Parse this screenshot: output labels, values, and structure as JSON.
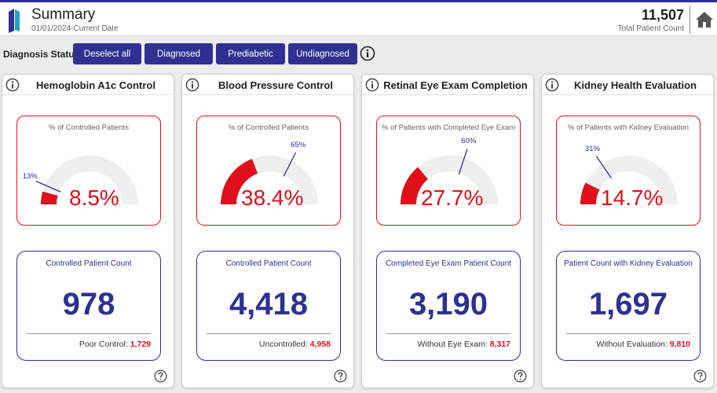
{
  "header": {
    "title": "Summary",
    "subtitle": "01/01/2024-Current Date",
    "total_count": "11,507",
    "total_label": "Total Patient Count"
  },
  "filters": {
    "label": "Diagnosis Status:",
    "buttons": [
      "Deselect all",
      "Diagnosed",
      "Prediabetic",
      "Undiagnosed"
    ]
  },
  "colors": {
    "navy": "#2e3192",
    "red": "#e0101a",
    "track": "#efefef"
  },
  "cards": [
    {
      "title": "Hemoglobin A1c Control",
      "gauge_caption": "% of Controlled Patients",
      "value_pct": 8.5,
      "value_label": "8.5%",
      "target_pct": 13,
      "target_label": "13%",
      "count_caption": "Controlled Patient Count",
      "count": "978",
      "sub_label": "Poor Control:",
      "sub_value": "1,729"
    },
    {
      "title": "Blood Pressure Control",
      "gauge_caption": "% of Controlled Patients",
      "value_pct": 38.4,
      "value_label": "38.4%",
      "target_pct": 65,
      "target_label": "65%",
      "count_caption": "Controlled Patient Count",
      "count": "4,418",
      "sub_label": "Uncontrolled:",
      "sub_value": "4,958"
    },
    {
      "title": "Retinal Eye Exam Completion",
      "gauge_caption": "% of Patients with Completed Eye Exam",
      "value_pct": 27.7,
      "value_label": "27.7%",
      "target_pct": 60,
      "target_label": "60%",
      "count_caption": "Completed Eye Exam Patient Count",
      "count": "3,190",
      "sub_label": "Without Eye Exam:",
      "sub_value": "8,317"
    },
    {
      "title": "Kidney Health Evaluation",
      "gauge_caption": "% of Patients with Kidney Evaluation",
      "value_pct": 14.7,
      "value_label": "14.7%",
      "target_pct": 31,
      "target_label": "31%",
      "count_caption": "Patient Count with Kidney Evaluation",
      "count": "1,697",
      "sub_label": "Without Evaluation:",
      "sub_value": "9,810"
    }
  ]
}
